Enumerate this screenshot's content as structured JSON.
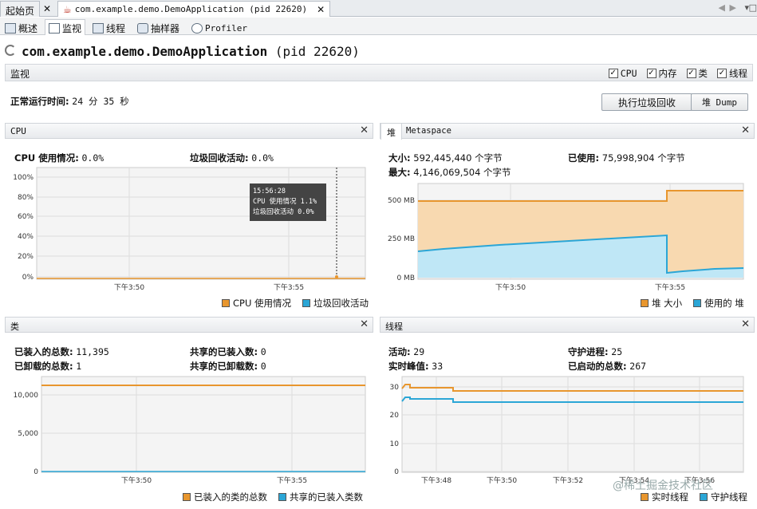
{
  "tabs": {
    "start": "起始页",
    "app": "com.example.demo.DemoApplication (pid 22620)",
    "close": "✕"
  },
  "subtabs": [
    "概述",
    "监视",
    "线程",
    "抽样器",
    "Profiler"
  ],
  "title": {
    "name": "com.example.demo.DemoApplication",
    "pid": "(pid 22620)"
  },
  "monitor": {
    "label": "监视",
    "checkboxes": [
      {
        "label": "CPU",
        "checked": true
      },
      {
        "label": "内存",
        "checked": true
      },
      {
        "label": "类",
        "checked": true
      },
      {
        "label": "线程",
        "checked": true
      }
    ],
    "uptime_label": "正常运行时间:",
    "uptime_value": "24 分 35 秒",
    "gc_button": "执行垃圾回收",
    "heap_dump_button": "堆 Dump"
  },
  "cpu": {
    "title": "CPU",
    "usage_label": "CPU 使用情况:",
    "usage_value": "0.0%",
    "gc_label": "垃圾回收活动:",
    "gc_value": "0.0%",
    "y_ticks": [
      "100%",
      "80%",
      "60%",
      "40%",
      "20%",
      "0%"
    ],
    "x_ticks": [
      "下午3:50",
      "下午3:55"
    ],
    "tooltip": [
      "15:56:28",
      "CPU 使用情况  1.1%",
      "垃圾回收活动  0.0%"
    ],
    "legend": [
      "CPU 使用情况",
      "垃圾回收活动"
    ]
  },
  "heap": {
    "tab_heap": "堆",
    "tab_meta": "Metaspace",
    "size_label": "大小:",
    "size_value": "592,445,440 个字节",
    "used_label": "已使用:",
    "used_value": "75,998,904 个字节",
    "max_label": "最大:",
    "max_value": "4,146,069,504 个字节",
    "y_ticks": [
      "500 MB",
      "250 MB",
      "0 MB"
    ],
    "x_ticks": [
      "下午3:50",
      "下午3:55"
    ],
    "legend": [
      "堆 大小",
      "使用的 堆"
    ]
  },
  "classes": {
    "title": "类",
    "loaded_label": "已装入的总数:",
    "loaded_value": "11,395",
    "unloaded_label": "已卸载的总数:",
    "unloaded_value": "1",
    "shared_loaded_label": "共享的已装入数:",
    "shared_loaded_value": "0",
    "shared_unloaded_label": "共享的已卸载数:",
    "shared_unloaded_value": "0",
    "y_ticks": [
      "10,000",
      "5,000",
      "0"
    ],
    "x_ticks": [
      "下午3:50",
      "下午3:55"
    ],
    "legend": [
      "已装入的类的总数",
      "共享的已装入类数"
    ]
  },
  "threads": {
    "title": "线程",
    "live_label": "活动:",
    "live_value": "29",
    "peak_label": "实时峰值:",
    "peak_value": "33",
    "daemon_label": "守护进程:",
    "daemon_value": "25",
    "started_label": "已启动的总数:",
    "started_value": "267",
    "y_ticks": [
      "30",
      "20",
      "10",
      "0"
    ],
    "x_ticks": [
      "下午3:48",
      "下午3:50",
      "下午3:52",
      "下午3:54",
      "下午3:56"
    ],
    "legend": [
      "实时线程",
      "守护线程"
    ]
  },
  "watermark": "@稀土掘金技术社区",
  "colors": {
    "orange": "#e8962e",
    "blue": "#2ba6d6",
    "orange_fill": "#f8d9b0",
    "blue_fill": "#bfe7f6"
  }
}
